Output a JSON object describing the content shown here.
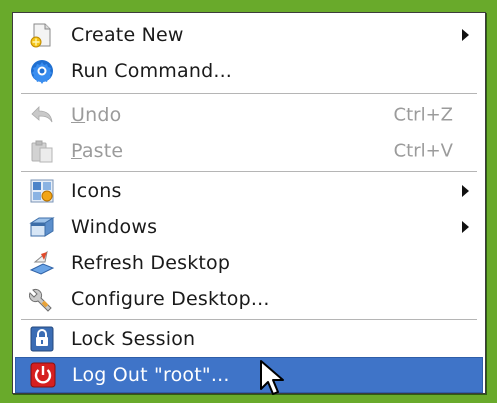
{
  "menu": {
    "create_new": {
      "label": "Create New",
      "icon": "new-document-icon",
      "has_submenu": true
    },
    "run_command": {
      "label": "Run Command...",
      "icon": "run-command-icon"
    },
    "undo": {
      "label": "Undo",
      "mnemonic": "U",
      "label_rest": "ndo",
      "shortcut": "Ctrl+Z",
      "icon": "undo-icon",
      "disabled": true
    },
    "paste": {
      "label": "Paste",
      "mnemonic": "P",
      "label_rest": "aste",
      "shortcut": "Ctrl+V",
      "icon": "paste-icon",
      "disabled": true
    },
    "icons": {
      "label": "Icons",
      "icon": "icons-icon",
      "has_submenu": true
    },
    "windows": {
      "label": "Windows",
      "icon": "windows-icon",
      "has_submenu": true
    },
    "refresh_desktop": {
      "label": "Refresh Desktop",
      "icon": "refresh-desktop-icon"
    },
    "configure_desktop": {
      "label": "Configure Desktop...",
      "icon": "configure-icon"
    },
    "lock_session": {
      "label": "Lock Session",
      "icon": "lock-icon"
    },
    "log_out": {
      "label": "Log Out \"root\"...",
      "icon": "logout-icon",
      "selected": true
    }
  },
  "colors": {
    "desktop_bg": "#69aa2b",
    "menu_bg": "#ffffff",
    "selection_bg": "#3f74c8",
    "disabled_text": "#9b9b9b"
  }
}
